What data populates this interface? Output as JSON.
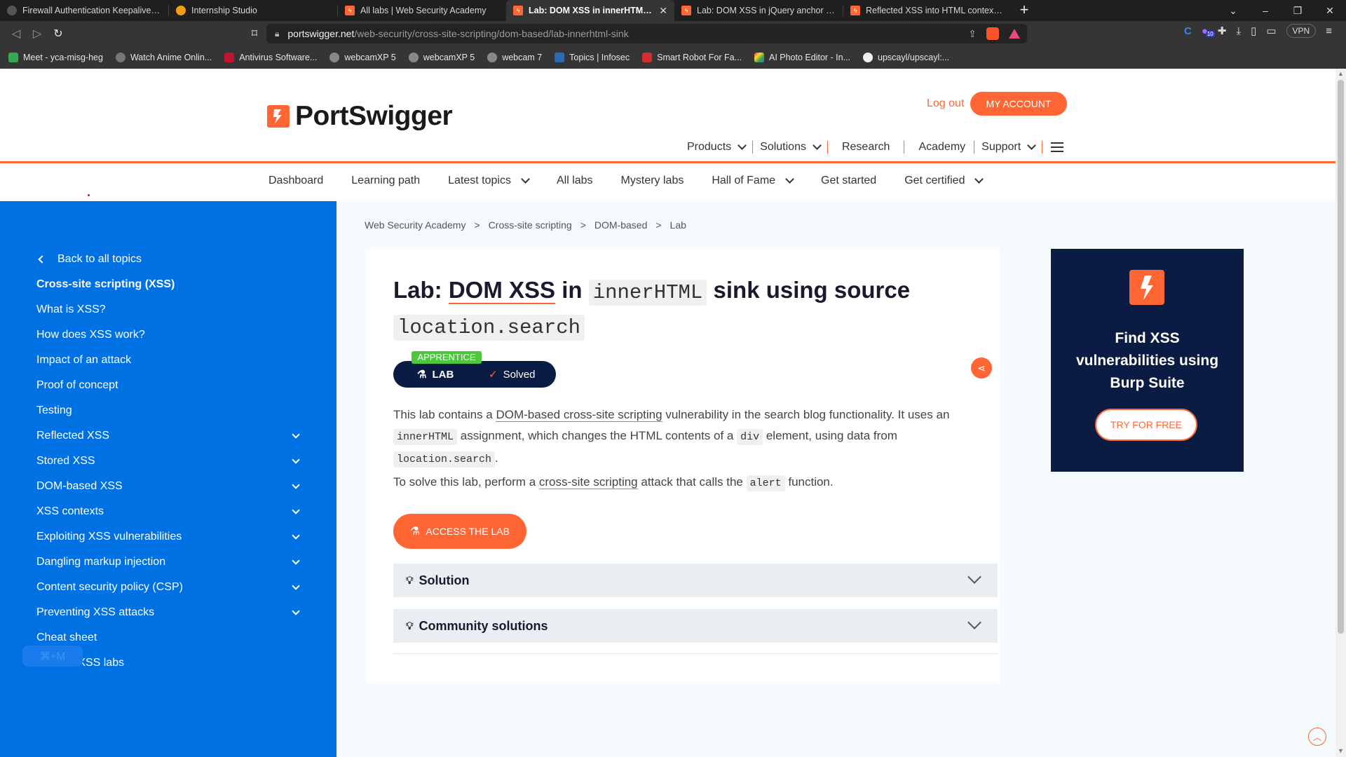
{
  "browser": {
    "tabs": [
      {
        "title": "Firewall Authentication Keepalive Wind",
        "icon": "globe-icon"
      },
      {
        "title": "Internship Studio",
        "icon": "internship-studio-icon"
      },
      {
        "title": "All labs | Web Security Academy",
        "icon": "portswigger-icon"
      },
      {
        "title": "Lab: DOM XSS in innerHTML sink",
        "icon": "portswigger-icon",
        "active": true
      },
      {
        "title": "Lab: DOM XSS in jQuery anchor href at",
        "icon": "portswigger-icon"
      },
      {
        "title": "Reflected XSS into HTML context with",
        "icon": "portswigger-icon"
      }
    ],
    "new_tab": "+",
    "url_host": "portswigger.net",
    "url_path": "/web-security/cross-site-scripting/dom-based/lab-innerhtml-sink",
    "vpn_label": "VPN",
    "extension_badge": "10",
    "bookmarks": [
      {
        "label": "Meet - yca-misg-heg",
        "color": "#34a853"
      },
      {
        "label": "Watch Anime Onlin...",
        "color": "#777777"
      },
      {
        "label": "Antivirus Software...",
        "color": "#c4122f"
      },
      {
        "label": "webcamXP 5",
        "color": "#888888"
      },
      {
        "label": "webcamXP 5",
        "color": "#888888"
      },
      {
        "label": "webcam 7",
        "color": "#888888"
      },
      {
        "label": "Topics | Infosec",
        "color": "#2b6cb0"
      },
      {
        "label": "Smart Robot For Fa...",
        "color": "#d32f2f"
      },
      {
        "label": "AI Photo Editor - In...",
        "color": "#7e57c2"
      },
      {
        "label": "upscayl/upscayl:...",
        "color": "#eeeeee"
      }
    ]
  },
  "header": {
    "brand": "PortSwigger",
    "logout": "Log out",
    "my_account": "MY ACCOUNT",
    "nav": [
      "Products",
      "Solutions",
      "Research",
      "Academy",
      "Support"
    ]
  },
  "subnav": [
    "Dashboard",
    "Learning path",
    "Latest topics",
    "All labs",
    "Mystery labs",
    "Hall of Fame",
    "Get started",
    "Get certified"
  ],
  "sidebar": {
    "back": "Back to all topics",
    "items": [
      "Cross-site scripting (XSS)",
      "What is XSS?",
      "How does XSS work?",
      "Impact of an attack",
      "Proof of concept",
      "Testing",
      "Reflected XSS",
      "Stored XSS",
      "DOM-based XSS",
      "XSS contexts",
      "Exploiting XSS vulnerabilities",
      "Dangling markup injection",
      "Content security policy (CSP)",
      "Preventing XSS attacks",
      "Cheat sheet",
      "View all XSS labs"
    ],
    "shortcut": "⌘+M"
  },
  "breadcrumb": [
    "Web Security Academy",
    "Cross-site scripting",
    "DOM-based",
    "Lab"
  ],
  "lab": {
    "title_prefix": "Lab: ",
    "title_link": "DOM XSS",
    "title_mid": " in ",
    "title_code1": "innerHTML",
    "title_after": " sink using source ",
    "title_code2": "location.search",
    "level": "APPRENTICE",
    "lab_label": "LAB",
    "status": "Solved",
    "desc_1": "This lab contains a ",
    "desc_link": "DOM-based cross-site scripting",
    "desc_2": " vulnerability in the search blog functionality. It uses an ",
    "desc_code1": "innerHTML",
    "desc_3": " assignment, which changes the HTML contents of a ",
    "desc_code2": "div",
    "desc_4": " element, using data from ",
    "desc_code3": "location.search",
    "desc_5": ".",
    "solve_1": "To solve this lab, perform a ",
    "solve_link": "cross-site scripting",
    "solve_2": " attack that calls the ",
    "solve_code": "alert",
    "solve_3": " function.",
    "access": "ACCESS THE LAB",
    "solution": "Solution",
    "community": "Community solutions"
  },
  "promo": {
    "heading": "Find XSS vulnerabilities using Burp Suite",
    "cta": "TRY FOR FREE"
  },
  "colors": {
    "accent": "#ff6633",
    "sidebar": "#0071e3",
    "navy": "#0a1c44",
    "badge_green": "#4ec73f"
  }
}
